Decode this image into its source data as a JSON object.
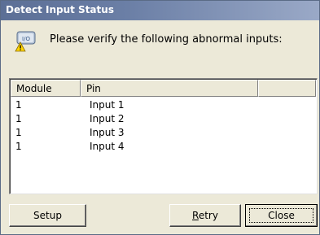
{
  "window": {
    "title": "Detect Input Status"
  },
  "header": {
    "message": "Please verify the following abnormal inputs:",
    "icon": "warning-io-icon"
  },
  "list": {
    "columns": [
      "Module",
      "Pin",
      ""
    ],
    "rows": [
      {
        "module": "1",
        "pin": "Input 1"
      },
      {
        "module": "1",
        "pin": "Input 2"
      },
      {
        "module": "1",
        "pin": "Input 3"
      },
      {
        "module": "1",
        "pin": "Input 4"
      }
    ]
  },
  "buttons": {
    "setup": "Setup",
    "retry_mnemonic": "R",
    "retry_rest": "etry",
    "close": "Close"
  }
}
